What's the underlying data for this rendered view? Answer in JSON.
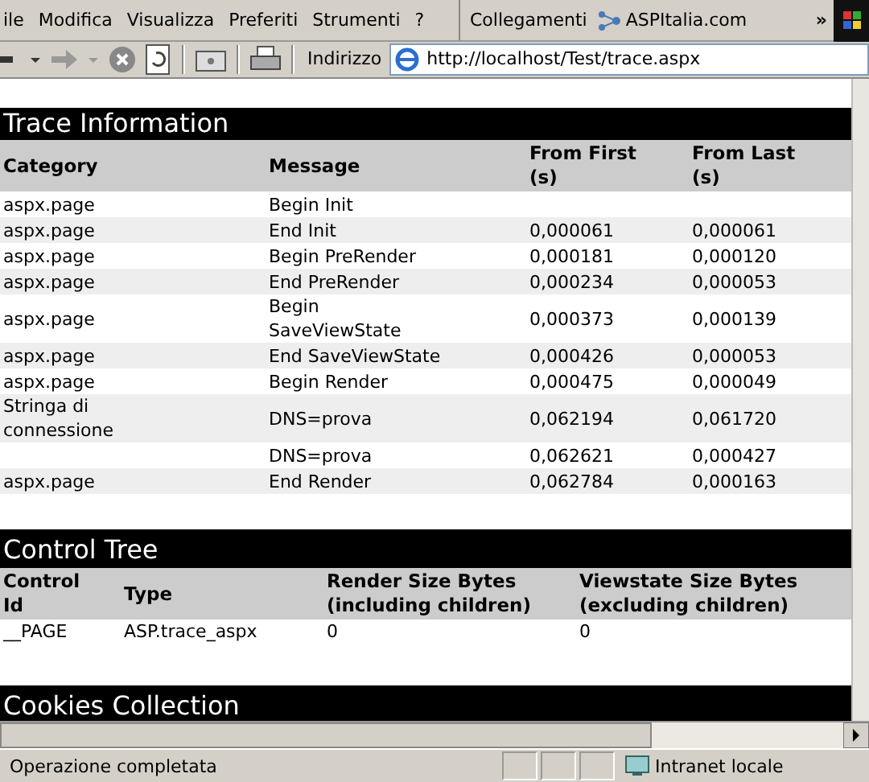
{
  "menu_bar": {
    "items": [
      "ile",
      "Modifica",
      "Visualizza",
      "Preferiti",
      "Strumenti",
      "?"
    ],
    "links_label": "Collegamenti",
    "links": [
      "ASPItalia.com"
    ],
    "more": "»"
  },
  "address_bar": {
    "label": "Indirizzo",
    "value": "http://localhost/Test/trace.aspx"
  },
  "trace_information": {
    "title": "Trace Information",
    "columns": [
      "Category",
      "Message",
      "From First (s)",
      "From Last (s)"
    ],
    "rows": [
      [
        "aspx.page",
        "Begin Init",
        "",
        ""
      ],
      [
        "aspx.page",
        "End Init",
        "0,000061",
        "0,000061"
      ],
      [
        "aspx.page",
        "Begin PreRender",
        "0,000181",
        "0,000120"
      ],
      [
        "aspx.page",
        "End PreRender",
        "0,000234",
        "0,000053"
      ],
      [
        "aspx.page",
        "Begin SaveViewState",
        "0,000373",
        "0,000139"
      ],
      [
        "aspx.page",
        "End SaveViewState",
        "0,000426",
        "0,000053"
      ],
      [
        "aspx.page",
        "Begin Render",
        "0,000475",
        "0,000049"
      ],
      [
        "Stringa di connessione",
        "DNS=prova",
        "0,062194",
        "0,061720"
      ],
      [
        "",
        "DNS=prova",
        "0,062621",
        "0,000427"
      ],
      [
        "aspx.page",
        "End Render",
        "0,062784",
        "0,000163"
      ]
    ]
  },
  "control_tree": {
    "title": "Control Tree",
    "columns": [
      "Control Id",
      "Type",
      "Render Size Bytes (including children)",
      "Viewstate Size Bytes (excluding children)"
    ],
    "rows": [
      [
        "__PAGE",
        "ASP.trace_aspx",
        "0",
        "0"
      ]
    ]
  },
  "cookies_collection": {
    "title": "Cookies Collection"
  },
  "status_bar": {
    "text": "Operazione completata",
    "zone": "Intranet locale"
  }
}
